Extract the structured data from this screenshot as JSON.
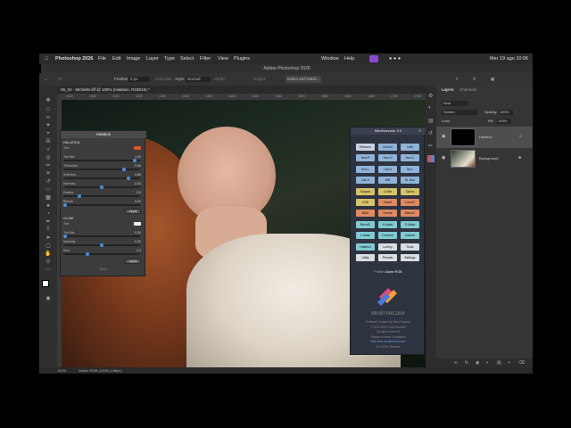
{
  "menubar": {
    "app": "Photoshop 2026",
    "items": [
      "File",
      "Edit",
      "Image",
      "Layer",
      "Type",
      "Select",
      "Filter",
      "View",
      "Plugins"
    ],
    "right_items": [
      "Window",
      "Help"
    ],
    "datetime": "Mer 19 ago  10:06"
  },
  "app_title": "Adobe Photoshop 2026",
  "options": {
    "feather": "Feather:",
    "feather_value": "0 px",
    "antialias": "Anti-alias",
    "style_label": "Style:",
    "style_value": "Normal",
    "width_label": "Width:",
    "height_label": "Height:",
    "select_mask": "Select and Mask..."
  },
  "doc_tab": "06_04 - Michelle.tiff @ 100% (Halation, RGB/16) *",
  "ruler_ticks": [
    "1000",
    "1050",
    "1100",
    "1150",
    "1200",
    "1250",
    "1300",
    "1350",
    "1400",
    "1450",
    "1500",
    "1550",
    "1600",
    "1650",
    "1700",
    "1750"
  ],
  "halation": {
    "title": "Halation",
    "section1": "HALATION",
    "rows": [
      {
        "label": "Tint",
        "value": ""
      },
      {
        "label": "Tint Mix",
        "value": "1.00",
        "level": 0.95
      },
      {
        "label": "Threshold",
        "value": "0.80",
        "level": 0.8
      },
      {
        "label": "Softness",
        "value": "0.86",
        "level": 0.86
      },
      {
        "label": "Intensity",
        "value": "2.00",
        "level": 0.5
      },
      {
        "label": "Radius",
        "value": "0.5",
        "level": 0.2
      },
      {
        "label": "Blends",
        "value": "0.00",
        "level": 0.0
      }
    ],
    "apply1": "Apply",
    "section2": "GLOW",
    "rows2": [
      {
        "label": "Tint",
        "value": ""
      },
      {
        "label": "Tint Mix",
        "value": "0.00",
        "level": 0.0
      },
      {
        "label": "Intensity",
        "value": "0.50",
        "level": 0.5
      },
      {
        "label": "Size",
        "value": "0.4",
        "level": 0.3
      }
    ],
    "apply2": "Apply",
    "footer": "Done",
    "tint_color": "#e0542a",
    "glow_tint_color": "#f0f0f0"
  },
  "mindthecolor": {
    "title": "MindHarcolor 3.0",
    "buttons": [
      {
        "label": "Retouch",
        "color": "#c9d2e0"
      },
      {
        "label": "CurveX",
        "color": "#8fb3d9"
      },
      {
        "label": "LAB",
        "color": "#8fb3d9"
      },
      {
        "label": "Hue-P",
        "color": "#8fb3d9"
      },
      {
        "label": "Hue-H",
        "color": "#8fb3d9"
      },
      {
        "label": "Hue-C",
        "color": "#8fb3d9"
      },
      {
        "label": "Hue-L",
        "color": "#8fb3d9"
      },
      {
        "label": "Lab-S",
        "color": "#8fb3d9"
      },
      {
        "label": "Sk-L",
        "color": "#8fb3d9"
      },
      {
        "label": "Sat-S",
        "color": "#8fb3d9"
      },
      {
        "label": "BW",
        "color": "#8fb3d9"
      },
      {
        "label": "SL Blur",
        "color": "#8fb3d9"
      },
      {
        "label": "Scapes",
        "color": "#d6c36a"
      },
      {
        "label": "Lit Me",
        "color": "#d6c36a"
      },
      {
        "label": "Optics",
        "color": "#d6c36a"
      },
      {
        "label": "CSE",
        "color": "#d6c36a"
      },
      {
        "label": "Shade",
        "color": "#e08a62"
      },
      {
        "label": "CorreG",
        "color": "#e08a62"
      },
      {
        "label": "BAW",
        "color": "#e08a62"
      },
      {
        "label": "Orientr",
        "color": "#e08a62"
      },
      {
        "label": "MatchC",
        "color": "#e08a62"
      },
      {
        "label": "BlendS",
        "color": "#7fcbd1"
      },
      {
        "label": "H-Mask",
        "color": "#7fcbd1"
      },
      {
        "label": "D-Mask",
        "color": "#7fcbd1"
      },
      {
        "label": "L-Mask",
        "color": "#7fcbd1"
      },
      {
        "label": "Connect",
        "color": "#7fcbd1"
      },
      {
        "label": "Volume",
        "color": "#7fcbd1"
      },
      {
        "label": "Halation",
        "color": "#7fcbd1"
      },
      {
        "label": "LuXmy",
        "color": "#d9dde4"
      },
      {
        "label": "Tools",
        "color": "#d9dde4"
      },
      {
        "label": "Utility",
        "color": "#d9dde4"
      },
      {
        "label": "Presets",
        "color": "#d9dde4"
      },
      {
        "label": "Settings",
        "color": "#d9dde4"
      }
    ],
    "profile_label": "Profile:",
    "profile_value": "Adobe RGB",
    "brand": "MindTheColor",
    "credits": [
      "Software Created by Carlo Durante",
      "© 2020-2026 Carlo Durante",
      "All rights reserved",
      "Thanks to Ivano Chiodarolo",
      "Visit www.mindthecolor.com",
      "3.0 Ilk Pro Release"
    ]
  },
  "layers": {
    "tabs": [
      "Layers",
      "Channels"
    ],
    "kind": "Kind",
    "mode": "Screen",
    "opacity_label": "Opacity:",
    "opacity": "100%",
    "lock_label": "Lock:",
    "fill_label": "Fill:",
    "fill": "100%",
    "rows": [
      {
        "name": "Halation",
        "selected": true
      },
      {
        "name": "Background",
        "selected": false
      }
    ]
  },
  "status": {
    "zoom": "100%",
    "profile": "Adobe RGB (1998) (16bpc)"
  }
}
